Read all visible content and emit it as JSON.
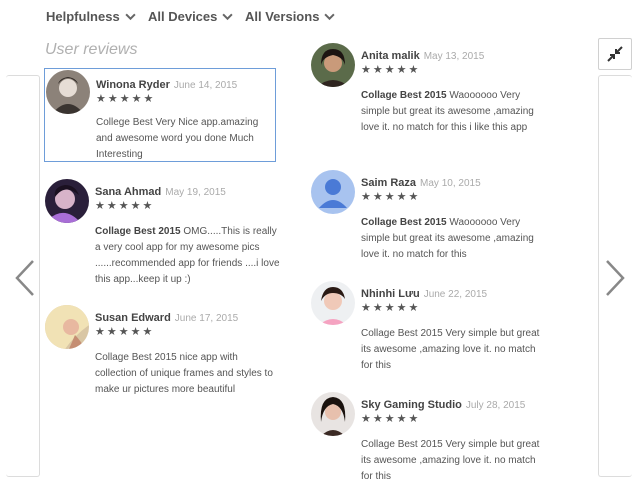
{
  "filters": {
    "sort": "Helpfulness",
    "devices": "All Devices",
    "versions": "All Versions"
  },
  "section_title": "User reviews",
  "icons": {
    "collapse": "collapse-arrows-icon",
    "prev": "chevron-left-icon",
    "next": "chevron-right-icon",
    "dropdown": "chevron-down-icon",
    "star": "★"
  },
  "colors": {
    "selected_border": "#6e9dd9",
    "default_avatar_bg": "#a8c3ef",
    "default_avatar_fg": "#4a7ad6"
  },
  "reviews_left": [
    {
      "author": "Winona Ryder",
      "date": "June 14, 2015",
      "stars": "★★★★★",
      "title": "",
      "body": "College Best Very Nice app.amazing and awesome word you done Much Interesting",
      "selected": true
    },
    {
      "author": "Sana Ahmad",
      "date": "May 19, 2015",
      "stars": "★★★★★",
      "title": "Collage Best 2015",
      "body": " OMG.....This is really a very cool app for my awesome pics ......recommended app for friends ....i love this app...keep it up :)"
    },
    {
      "author": "Susan Edward",
      "date": "June 17, 2015",
      "stars": "★★★★★",
      "title": "",
      "body": "Collage Best 2015 nice app with collection of unique frames and styles to make ur pictures more beautiful"
    }
  ],
  "reviews_right": [
    {
      "author": "Anita malik",
      "date": "May 13, 2015",
      "stars": "★★★★★",
      "title": "Collage Best 2015",
      "body": " Waoooooo Very simple but great its awesome ,amazing love it. no match for this i like this app"
    },
    {
      "author": "Saim Raza",
      "date": "May 10, 2015",
      "stars": "★★★★★",
      "title": "Collage Best 2015",
      "body": " Waoooooo Very simple but great its awesome ,amazing love it. no match for this"
    },
    {
      "author": "Nhinhi Lưu",
      "date": "June 22, 2015",
      "stars": "★★★★★",
      "title": "",
      "body": "Collage Best 2015 Very simple but great its awesome ,amazing love it. no match for this"
    },
    {
      "author": "Sky Gaming Studio",
      "date": "July 28, 2015",
      "stars": "★★★★★",
      "title": "",
      "body": "Collage Best 2015 Very simple but great its awesome ,amazing love it. no match for this"
    }
  ]
}
